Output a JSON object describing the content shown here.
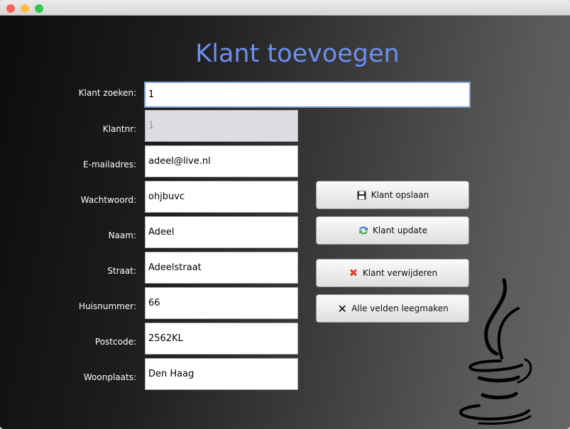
{
  "title": "Klant toevoegen",
  "search": {
    "label": "Klant zoeken:",
    "value": "1"
  },
  "fields": [
    {
      "label": "Klantnr:",
      "value": "1",
      "disabled": true
    },
    {
      "label": "E-mailadres:",
      "value": "adeel@live.nl"
    },
    {
      "label": "Wachtwoord:",
      "value": "ohjbuvc"
    },
    {
      "label": "Naam:",
      "value": "Adeel"
    },
    {
      "label": "Straat:",
      "value": "Adeelstraat"
    },
    {
      "label": "Huisnummer:",
      "value": "66"
    },
    {
      "label": "Postcode:",
      "value": "2562KL"
    },
    {
      "label": "Woonplaats:",
      "value": "Den Haag"
    }
  ],
  "buttons": {
    "save": "Klant opslaan",
    "update": "Klant update",
    "delete": "Klant verwijderen",
    "clear": "Alle velden leegmaken"
  },
  "colors": {
    "title": "#6c8ff0",
    "close": "#fc605c",
    "minimize": "#fdbc40",
    "zoom": "#34c84a"
  }
}
